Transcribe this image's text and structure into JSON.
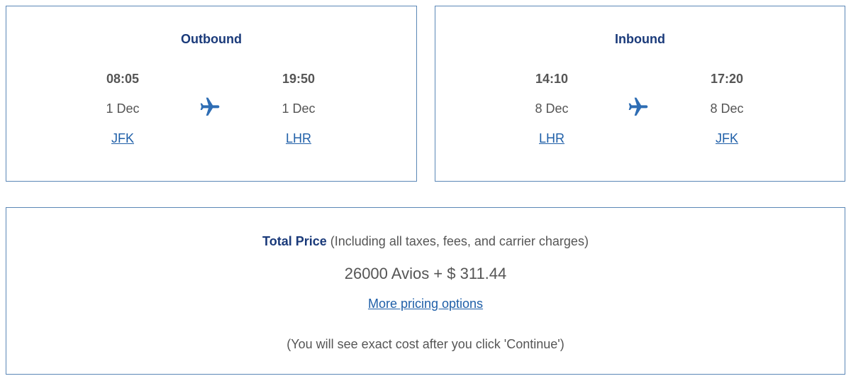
{
  "outbound": {
    "title": "Outbound",
    "departure": {
      "time": "08:05",
      "date": "1 Dec",
      "airport": "JFK"
    },
    "arrival": {
      "time": "19:50",
      "date": "1 Dec",
      "airport": "LHR"
    },
    "icon": "plane-icon"
  },
  "inbound": {
    "title": "Inbound",
    "departure": {
      "time": "14:10",
      "date": "8 Dec",
      "airport": "LHR"
    },
    "arrival": {
      "time": "17:20",
      "date": "8 Dec",
      "airport": "JFK"
    },
    "icon": "plane-icon"
  },
  "price": {
    "label": "Total Price",
    "qualifier": "(Including all taxes, fees, and carrier charges)",
    "value": "26000 Avios + $ 311.44",
    "more_options_link": "More pricing options",
    "note": "(You will see exact cost after you click 'Continue')"
  },
  "colors": {
    "heading": "#1a3a7a",
    "link": "#1f5fa8",
    "text": "#555555",
    "border": "#5b87b6",
    "icon": "#2e6db4"
  }
}
